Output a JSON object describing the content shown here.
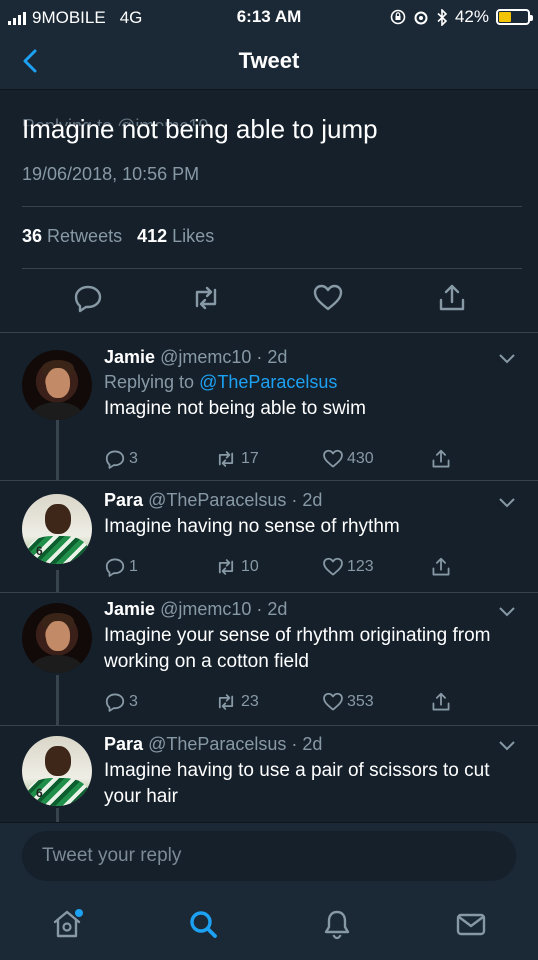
{
  "status_bar": {
    "carrier": "9MOBILE",
    "network": "4G",
    "time": "6:13 AM",
    "battery": "42%",
    "battery_level": 0.42
  },
  "nav": {
    "title": "Tweet",
    "cutoff_text": "Replying to @jmemc10"
  },
  "main_tweet": {
    "text": "Imagine not being able to jump",
    "date": "19/06/2018, 10:56 PM",
    "retweets_count": "36",
    "retweets_label": "Retweets",
    "likes_count": "412",
    "likes_label": "Likes"
  },
  "replies": [
    {
      "name": "Jamie",
      "handle": "@jmemc10",
      "time": "· 2d",
      "replying_label": "Replying to",
      "replying_to": "@TheParacelsus",
      "text": "Imagine not being able to swim",
      "replies": "3",
      "retweets": "17",
      "likes": "430"
    },
    {
      "name": "Para",
      "handle": "@TheParacelsus",
      "time": "· 2d",
      "text": "Imagine having no sense of rhythm",
      "replies": "1",
      "retweets": "10",
      "likes": "123"
    },
    {
      "name": "Jamie",
      "handle": "@jmemc10",
      "time": "· 2d",
      "text": "Imagine your sense of rhythm originating from working on a cotton field",
      "replies": "3",
      "retweets": "23",
      "likes": "353"
    },
    {
      "name": "Para",
      "handle": "@TheParacelsus",
      "time": "· 2d",
      "text": "Imagine having to use a pair of scissors to cut your hair"
    }
  ],
  "compose": {
    "placeholder": "Tweet your reply"
  },
  "colors": {
    "background": "#15202b",
    "accent": "#1da1f2",
    "muted": "#8899a6",
    "battery": "#f5c400"
  },
  "icons": {
    "nav_back": "chevron-left-icon",
    "tweet_actions": [
      "reply-icon",
      "retweet-icon",
      "like-icon",
      "share-icon"
    ],
    "tab_bar": [
      "home-icon",
      "search-icon",
      "notifications-icon",
      "messages-icon"
    ]
  }
}
